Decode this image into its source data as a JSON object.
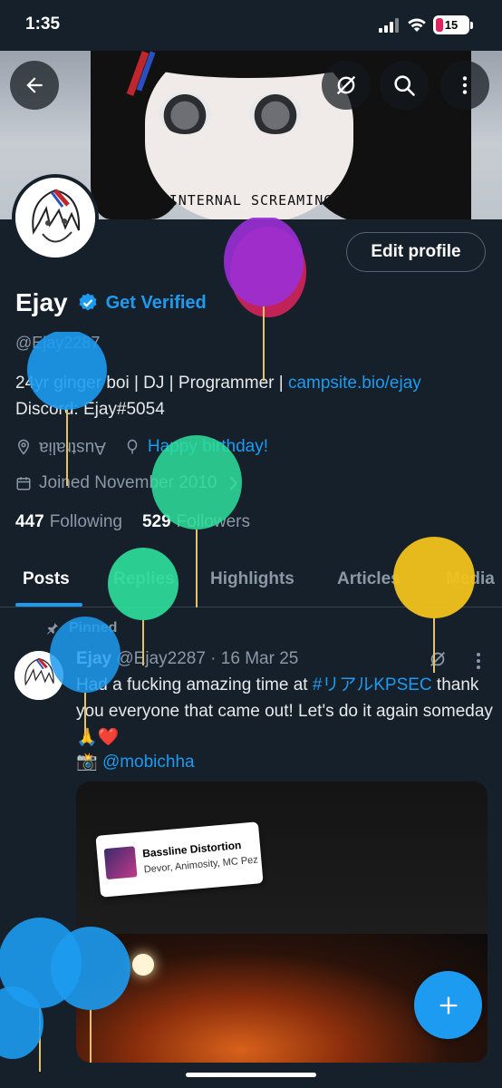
{
  "status_bar": {
    "time": "1:35",
    "battery": "15"
  },
  "banner": {
    "caption": "[INTERNAL SCREAMING]"
  },
  "profile": {
    "edit_button": "Edit profile",
    "name": "Ejay",
    "get_verified": "Get Verified",
    "handle": "@Ejay2287",
    "bio_text": "24yr ginger boi | DJ |  Programmer | ",
    "bio_link": "campsite.bio/ejay",
    "bio_line2": "Discord: Ejay#5054",
    "location": "Australia",
    "birthday": "Happy birthday!",
    "joined": "Joined November 2010",
    "following_count": "447",
    "following_label": "Following",
    "followers_count": "529",
    "followers_label": "Followers"
  },
  "tabs": [
    {
      "label": "Posts",
      "active": true
    },
    {
      "label": "Replies"
    },
    {
      "label": "Highlights"
    },
    {
      "label": "Articles"
    },
    {
      "label": "Media"
    }
  ],
  "pinned_post": {
    "pinned_label": "Pinned",
    "author": "Ejay",
    "handle_date": "@Ejay2287 · 16 Mar 25",
    "text_before": "Had a fucking amazing time at ",
    "hashtag": "#リアルKPSEC",
    "text_after": " thank you everyone that came out! Let's do it again someday 🙏❤️",
    "credit_prefix": "📸 ",
    "credit_handle": "@mobichha",
    "media_song_title": "Bassline Distortion",
    "media_song_artists": "Devor, Animosity, MC Pez"
  },
  "colors": {
    "accent": "#1d9bf0",
    "background": "#15202b"
  }
}
